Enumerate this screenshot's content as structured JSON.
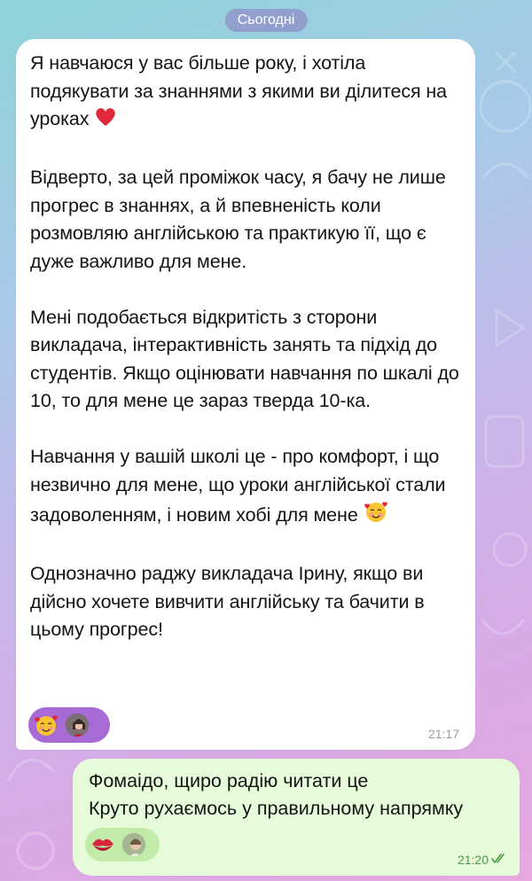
{
  "date_separator": "Сьогодні",
  "incoming": {
    "paragraphs": [
      "Я навчаюся у вас більше року, і хотіла подякувати за знаннями з якими ви ділитеся на уроках",
      "Відверто, за цей проміжок часу, я бачу не лише прогрес в знаннях, а й впевненість коли розмовляю англійською та практикую її, що є дуже важливо для мене.",
      "Мені подобається відкритість з сторони викладача, інтерактивність занять та підхід до студентів. Якщо оцінювати навчання по шкалі до 10, то для мене це зараз тверда 10-ка.",
      "Навчання у вашій школі це - про комфорт, і що незвично для мене, що уроки англійської стали задоволенням, і новим хобі для мене",
      "Однозначно раджу викладача Ірину, якщо ви дійсно хочете вивчити англійську та бачити в цьому прогрес!"
    ],
    "time": "21:17",
    "reaction_icon": "smiling-face-with-hearts-icon"
  },
  "outgoing": {
    "lines": [
      "Фомаідо, щиро радію читати це",
      "Круто рухаємось у правильному напрямку"
    ],
    "time": "21:20",
    "reaction_icon": "kiss-mark-icon",
    "status_icon": "double-check-icon"
  },
  "colors": {
    "incoming_bubble": "#ffffff",
    "outgoing_bubble": "#e6fbd9",
    "reaction_incoming": "#a86bd6",
    "reaction_outgoing": "#c2eba9",
    "read_check": "#4c9a46"
  }
}
